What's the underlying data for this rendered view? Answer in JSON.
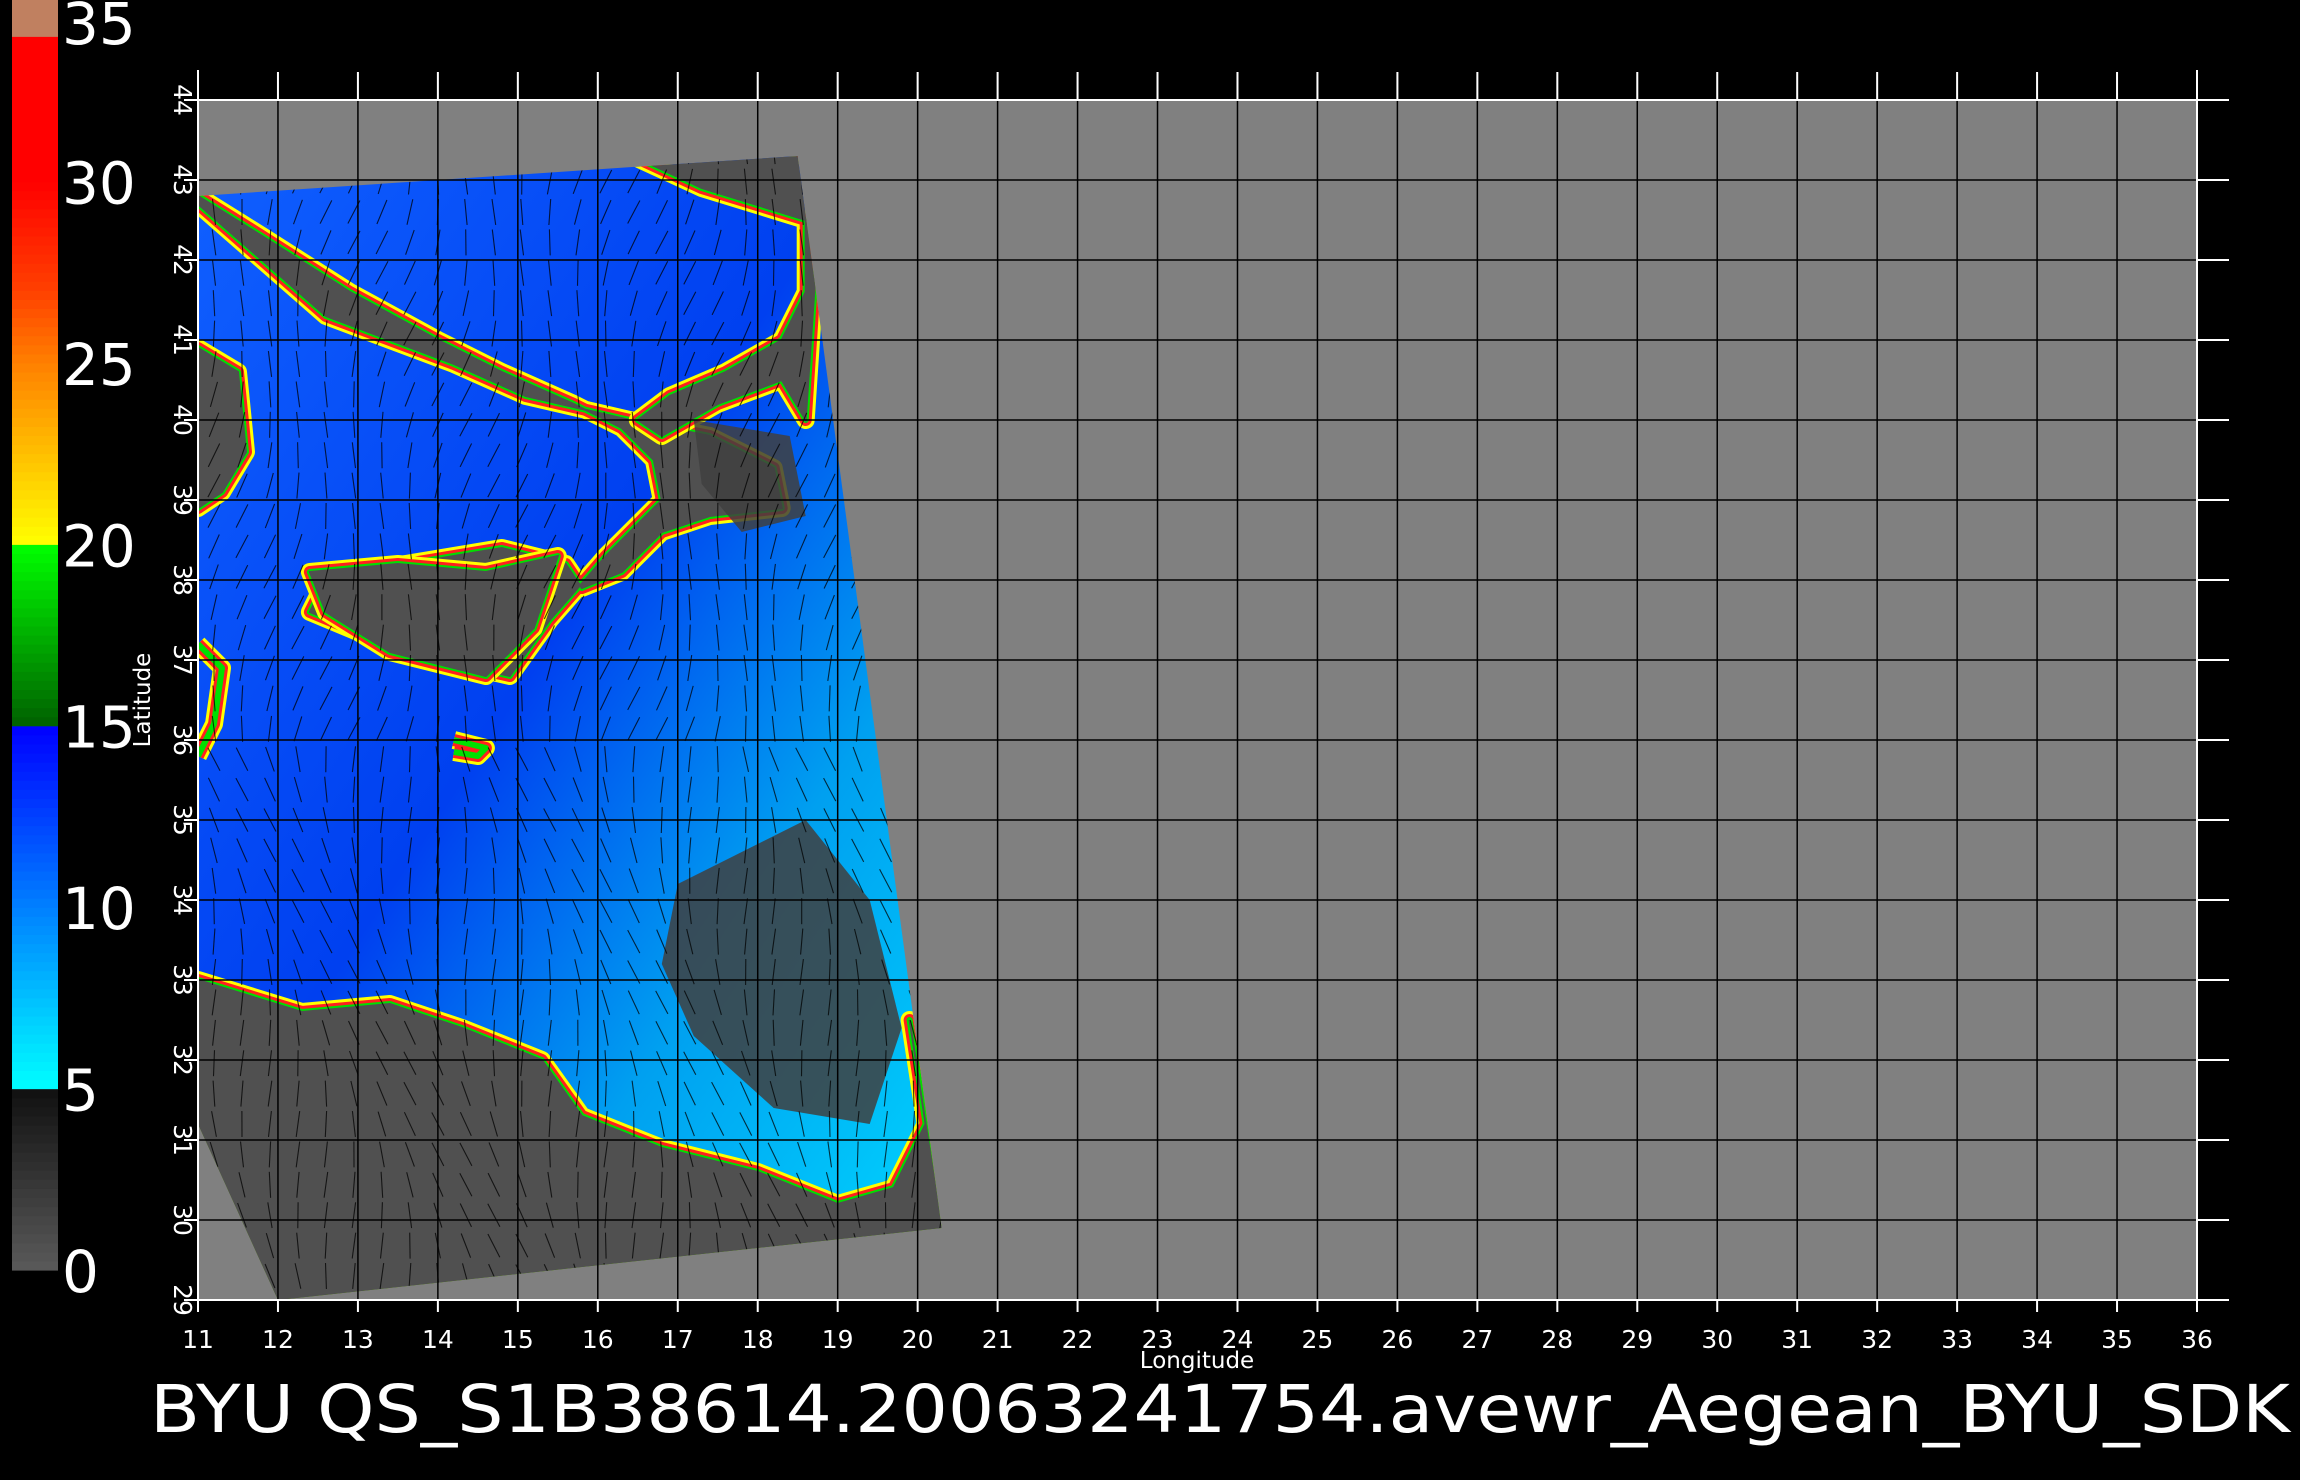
{
  "colors": {
    "background": "#000000",
    "no_data": "#808080",
    "swath_land": "#505050",
    "grid": "#000000",
    "frame": "#ffffff",
    "wind_vector": "#000000"
  },
  "map": {
    "footer_text": "BYU  QS_S1B38614.20063241754.avewr_Aegean_BYU_SDK",
    "xlabel": "Longitude",
    "ylabel": "Latitude",
    "x_axis": {
      "min": 11,
      "max": 36,
      "ticks": [
        "11",
        "12",
        "13",
        "14",
        "15",
        "16",
        "17",
        "18",
        "19",
        "20",
        "21",
        "22",
        "23",
        "24",
        "25",
        "26",
        "27",
        "28",
        "29",
        "30",
        "31",
        "32",
        "33",
        "34",
        "35",
        "36"
      ]
    },
    "y_axis": {
      "min": 29,
      "max": 44,
      "ticks": [
        "29",
        "30",
        "31",
        "32",
        "33",
        "34",
        "35",
        "36",
        "37",
        "38",
        "39",
        "40",
        "41",
        "42",
        "43",
        "44"
      ]
    },
    "swath": {
      "corners_lonlat": [
        [
          11.0,
          42.8
        ],
        [
          18.5,
          43.3
        ],
        [
          20.3,
          29.9
        ],
        [
          12.0,
          29.0
        ],
        [
          11.0,
          31.2
        ]
      ]
    },
    "land_masses": [
      {
        "name": "italy-peninsula",
        "lonlat": [
          [
            11.0,
            42.7
          ],
          [
            12.6,
            41.3
          ],
          [
            14.2,
            40.7
          ],
          [
            15.1,
            40.3
          ],
          [
            16.4,
            40.0
          ],
          [
            17.4,
            39.8
          ],
          [
            18.2,
            39.4
          ],
          [
            18.3,
            38.9
          ],
          [
            17.4,
            38.8
          ],
          [
            16.8,
            38.6
          ],
          [
            16.3,
            38.1
          ],
          [
            15.8,
            37.9
          ],
          [
            15.6,
            38.2
          ],
          [
            14.8,
            38.4
          ],
          [
            13.6,
            38.2
          ],
          [
            12.6,
            38.0
          ],
          [
            12.4,
            37.6
          ],
          [
            13.6,
            37.1
          ],
          [
            14.9,
            36.8
          ],
          [
            15.4,
            37.5
          ],
          [
            16.1,
            38.3
          ],
          [
            16.8,
            39.0
          ],
          [
            16.7,
            39.5
          ],
          [
            16.3,
            39.9
          ],
          [
            15.7,
            40.2
          ],
          [
            14.8,
            40.6
          ],
          [
            14.0,
            41.0
          ],
          [
            12.9,
            41.6
          ],
          [
            11.8,
            42.3
          ],
          [
            11.0,
            42.8
          ]
        ]
      },
      {
        "name": "balkans",
        "lonlat": [
          [
            14.0,
            43.8
          ],
          [
            16.0,
            43.5
          ],
          [
            17.3,
            42.9
          ],
          [
            18.6,
            42.5
          ],
          [
            18.6,
            41.6
          ],
          [
            18.3,
            41.0
          ],
          [
            17.6,
            40.6
          ],
          [
            16.9,
            40.3
          ],
          [
            16.5,
            40.0
          ],
          [
            16.8,
            39.8
          ],
          [
            17.5,
            40.2
          ],
          [
            18.3,
            40.5
          ],
          [
            18.6,
            40.0
          ],
          [
            18.8,
            43.0
          ],
          [
            18.5,
            43.4
          ],
          [
            14.0,
            43.8
          ]
        ]
      },
      {
        "name": "libya",
        "lonlat": [
          [
            11.0,
            33.0
          ],
          [
            12.3,
            32.6
          ],
          [
            13.4,
            32.7
          ],
          [
            14.3,
            32.4
          ],
          [
            15.3,
            32.0
          ],
          [
            15.8,
            31.3
          ],
          [
            16.8,
            30.9
          ],
          [
            18.0,
            30.6
          ],
          [
            19.0,
            30.2
          ],
          [
            19.7,
            30.4
          ],
          [
            20.1,
            31.2
          ],
          [
            19.9,
            32.5
          ],
          [
            20.3,
            29.9
          ],
          [
            12.0,
            29.0
          ],
          [
            11.0,
            31.2
          ],
          [
            11.0,
            33.0
          ]
        ]
      },
      {
        "name": "sicily-west",
        "lonlat": [
          [
            12.4,
            38.1
          ],
          [
            13.5,
            38.2
          ],
          [
            14.6,
            38.1
          ],
          [
            15.5,
            38.3
          ],
          [
            15.2,
            37.4
          ],
          [
            14.6,
            36.8
          ],
          [
            13.4,
            37.1
          ],
          [
            12.6,
            37.6
          ],
          [
            12.4,
            38.1
          ]
        ]
      },
      {
        "name": "sardinia-tip",
        "lonlat": [
          [
            11.0,
            40.9
          ],
          [
            11.5,
            40.6
          ],
          [
            11.6,
            39.6
          ],
          [
            11.3,
            39.1
          ],
          [
            11.0,
            38.9
          ]
        ]
      },
      {
        "name": "tunisia-coast",
        "lonlat": [
          [
            11.0,
            37.2
          ],
          [
            11.3,
            36.9
          ],
          [
            11.2,
            36.2
          ],
          [
            11.0,
            35.8
          ]
        ]
      },
      {
        "name": "malta",
        "lonlat": [
          [
            14.2,
            36.0
          ],
          [
            14.6,
            35.9
          ],
          [
            14.5,
            35.8
          ],
          [
            14.2,
            35.85
          ]
        ]
      }
    ]
  },
  "colorbar": {
    "labels": [
      "0",
      "5",
      "10",
      "15",
      "20",
      "25",
      "30",
      "35"
    ],
    "range": [
      0,
      35
    ],
    "stops": [
      {
        "value": 0,
        "color": "#5a5a5a"
      },
      {
        "value": 5,
        "color": "#101010"
      },
      {
        "value": 5.01,
        "color": "#00ffff"
      },
      {
        "value": 10,
        "color": "#0080ff"
      },
      {
        "value": 15,
        "color": "#0000ff"
      },
      {
        "value": 15.01,
        "color": "#006000"
      },
      {
        "value": 20,
        "color": "#00ff00"
      },
      {
        "value": 20.01,
        "color": "#ffff00"
      },
      {
        "value": 25,
        "color": "#ff8000"
      },
      {
        "value": 27,
        "color": "#ff4000"
      },
      {
        "value": 30,
        "color": "#ff0000"
      },
      {
        "value": 34,
        "color": "#ff0000"
      },
      {
        "value": 34.01,
        "color": "#c08060"
      },
      {
        "value": 35,
        "color": "#c08060"
      }
    ]
  }
}
